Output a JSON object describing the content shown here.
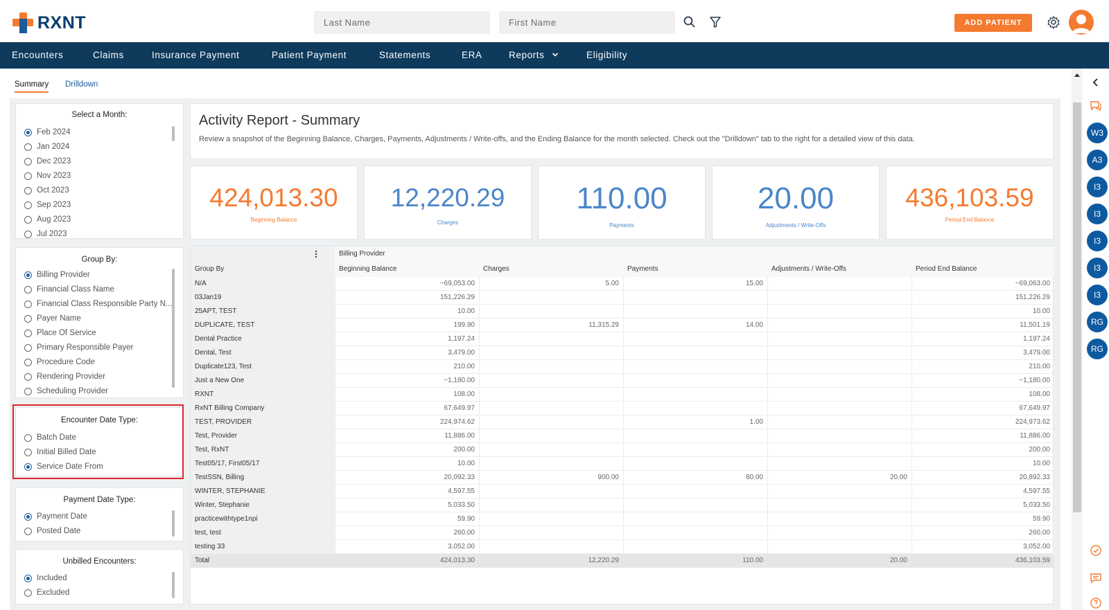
{
  "header": {
    "logo_text": "RXNT",
    "last_name_placeholder": "Last Name",
    "first_name_placeholder": "First Name",
    "add_patient_label": "ADD PATIENT"
  },
  "nav": {
    "items": [
      "Encounters",
      "Claims",
      "Insurance Payment",
      "Patient Payment",
      "Statements",
      "ERA",
      "Reports",
      "Eligibility"
    ]
  },
  "tabs": {
    "summary": "Summary",
    "drilldown": "Drilldown"
  },
  "filters": {
    "month": {
      "title": "Select a Month:",
      "options": [
        "Feb 2024",
        "Jan 2024",
        "Dec 2023",
        "Nov 2023",
        "Oct 2023",
        "Sep 2023",
        "Aug 2023",
        "Jul 2023"
      ],
      "selected": 0
    },
    "group_by": {
      "title": "Group By:",
      "options": [
        "Billing Provider",
        "Financial Class Name",
        "Financial Class Responsible Party N...",
        "Payer Name",
        "Place Of Service",
        "Primary Responsible Payer",
        "Procedure Code",
        "Rendering Provider",
        "Scheduling Provider"
      ],
      "selected": 0
    },
    "encounter_date_type": {
      "title": "Encounter Date Type:",
      "options": [
        "Batch Date",
        "Initial Billed Date",
        "Service Date From"
      ],
      "selected": 2
    },
    "payment_date_type": {
      "title": "Payment Date Type:",
      "options": [
        "Payment Date",
        "Posted Date"
      ],
      "selected": 0
    },
    "unbilled_encounters": {
      "title": "Unbilled Encounters:",
      "options": [
        "Included",
        "Excluded"
      ],
      "selected": 0
    }
  },
  "summary": {
    "title": "Activity Report - Summary",
    "description": "Review a snapshot of the Beginning Balance, Charges, Payments, Adjustments / Write-offs, and the Ending Balance for the month selected. Check out the \"Drilldown\" tab to the right for a detailed view of this data."
  },
  "cards": [
    {
      "value": "424,013.30",
      "label": "Beginning Balance",
      "color": "#f47a30"
    },
    {
      "value": "12,220.29",
      "label": "Charges",
      "color": "#4a86c8"
    },
    {
      "value": "110.00",
      "label": "Payments",
      "color": "#4a86c8"
    },
    {
      "value": "20.00",
      "label": "Adjustments / Write-Offs",
      "color": "#4a86c8"
    },
    {
      "value": "436,103.59",
      "label": "Period End Balance",
      "color": "#f47a30"
    }
  ],
  "table": {
    "group_header": "Billing Provider",
    "menu_icon": "more-vert-icon",
    "columns": [
      "Group By",
      "Beginning Balance",
      "Charges",
      "Payments",
      "Adjustments / Write-Offs",
      "Period End Balance"
    ],
    "rows": [
      [
        "N/A",
        "−69,053.00",
        "5.00",
        "15.00",
        "",
        "−69,063.00"
      ],
      [
        "03Jan19",
        "151,226.29",
        "",
        "",
        "",
        "151,226.29"
      ],
      [
        "25APT, TEST",
        "10.00",
        "",
        "",
        "",
        "10.00"
      ],
      [
        "DUPLICATE, TEST",
        "199.90",
        "11,315.29",
        "14.00",
        "",
        "11,501.19"
      ],
      [
        "Dental Practice",
        "1,197.24",
        "",
        "",
        "",
        "1,197.24"
      ],
      [
        "Dental, Test",
        "3,479.00",
        "",
        "",
        "",
        "3,479.00"
      ],
      [
        "Duplicate123, Test",
        "210.00",
        "",
        "",
        "",
        "210.00"
      ],
      [
        "Just a New One",
        "−1,180.00",
        "",
        "",
        "",
        "−1,180.00"
      ],
      [
        "RXNT",
        "108.00",
        "",
        "",
        "",
        "108.00"
      ],
      [
        "RxNT Billing Company",
        "67,649.97",
        "",
        "",
        "",
        "67,649.97"
      ],
      [
        "TEST, PROVIDER",
        "224,974.62",
        "",
        "1.00",
        "",
        "224,973.62"
      ],
      [
        "Test, Provider",
        "11,886.00",
        "",
        "",
        "",
        "11,886.00"
      ],
      [
        "Test, RxNT",
        "200.00",
        "",
        "",
        "",
        "200.00"
      ],
      [
        "Test05/17, First05/17",
        "10.00",
        "",
        "",
        "",
        "10.00"
      ],
      [
        "TestSSN, Billing",
        "20,092.33",
        "900.00",
        "80.00",
        "20.00",
        "20,892.33"
      ],
      [
        "WINTER, STEPHANIE",
        "4,597.55",
        "",
        "",
        "",
        "4,597.55"
      ],
      [
        "Winter, Stephanie",
        "5,033.50",
        "",
        "",
        "",
        "5,033.50"
      ],
      [
        "practicewithtype1npi",
        "59.90",
        "",
        "",
        "",
        "59.90"
      ],
      [
        "test, test",
        "260.00",
        "",
        "",
        "",
        "260.00"
      ],
      [
        "testing 33",
        "3,052.00",
        "",
        "",
        "",
        "3,052.00"
      ]
    ],
    "total": [
      "Total",
      "424,013.30",
      "12,220.29",
      "110.00",
      "20.00",
      "436,103.59"
    ]
  },
  "rail": {
    "badges": [
      "W3",
      "A3",
      "I3",
      "I3",
      "I3",
      "I3",
      "I3",
      "RG",
      "RG"
    ],
    "badge_color": "#0e5aa0"
  }
}
